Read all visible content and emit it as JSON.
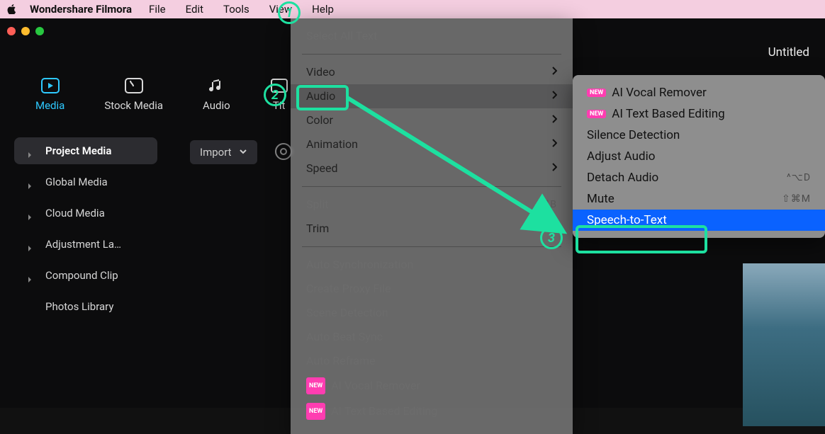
{
  "menubar": {
    "app_name": "Wondershare Filmora",
    "items": [
      "File",
      "Edit",
      "Tools",
      "View",
      "Help"
    ]
  },
  "window": {
    "doc_title": "Untitled"
  },
  "toolbar": {
    "items": [
      {
        "label": "Media",
        "icon": "media-icon",
        "active": true
      },
      {
        "label": "Stock Media",
        "icon": "stock-icon"
      },
      {
        "label": "Audio",
        "icon": "audio-icon"
      },
      {
        "label": "Tit",
        "icon": "titles-icon"
      }
    ]
  },
  "import_button": {
    "label": "Import"
  },
  "sidebar": {
    "items": [
      {
        "label": "Project Media",
        "strong": true
      },
      {
        "label": "Global Media"
      },
      {
        "label": "Cloud Media"
      },
      {
        "label": "Adjustment La…"
      },
      {
        "label": "Compound Clip"
      },
      {
        "label": "Photos Library",
        "noarrow": true
      }
    ]
  },
  "tools_menu": {
    "items": [
      {
        "label": "Select All Text",
        "disabled": true,
        "key": "select-all-text"
      },
      {
        "sep": true
      },
      {
        "label": "Video",
        "submenu": true,
        "key": "video"
      },
      {
        "label": "Audio",
        "submenu": true,
        "highlight": true,
        "key": "audio"
      },
      {
        "label": "Color",
        "submenu": true,
        "key": "color"
      },
      {
        "label": "Animation",
        "submenu": true,
        "key": "animation"
      },
      {
        "label": "Speed",
        "submenu": true,
        "key": "speed"
      },
      {
        "sep": true
      },
      {
        "label": "Split",
        "disabled": true,
        "shortcut": "⌘B",
        "key": "split"
      },
      {
        "label": "Trim",
        "submenu": true,
        "key": "trim"
      },
      {
        "sep": true
      },
      {
        "label": "Auto Synchronization",
        "disabled": true,
        "key": "auto-sync"
      },
      {
        "label": "Create Proxy File",
        "disabled": true,
        "key": "proxy"
      },
      {
        "label": "Scene Detection",
        "disabled": true,
        "key": "scene-detection"
      },
      {
        "label": "Auto Beat Sync",
        "disabled": true,
        "key": "beat-sync"
      },
      {
        "label": "Auto Reframe",
        "disabled": true,
        "key": "auto-reframe"
      },
      {
        "label": "AI Vocal Remover",
        "disabled": true,
        "badge": "NEW",
        "key": "vocal-remover"
      },
      {
        "label": "AI Text Based Editing",
        "disabled": true,
        "badge": "NEW",
        "key": "text-based-editing"
      }
    ]
  },
  "audio_submenu": {
    "items": [
      {
        "label": "AI Vocal Remover",
        "badge": "NEW",
        "key": "ai-vocal-remover"
      },
      {
        "label": "AI Text Based Editing",
        "badge": "NEW",
        "key": "ai-text-based-editing"
      },
      {
        "label": "Silence Detection",
        "key": "silence-detection"
      },
      {
        "label": "Adjust Audio",
        "key": "adjust-audio"
      },
      {
        "label": "Detach Audio",
        "shortcut": "^⌥D",
        "key": "detach-audio"
      },
      {
        "label": "Mute",
        "shortcut": "⇧⌘M",
        "key": "mute"
      },
      {
        "label": "Speech-to-Text",
        "selected": true,
        "key": "speech-to-text"
      }
    ]
  },
  "annotations": {
    "circle1": "1",
    "circle2": "2",
    "circle3": "3"
  }
}
